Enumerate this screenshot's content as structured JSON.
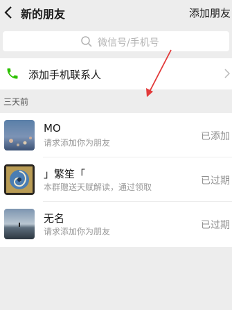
{
  "nav": {
    "title": "新的朋友",
    "action": "添加朋友"
  },
  "search": {
    "placeholder": "微信号/手机号"
  },
  "phone_contacts": {
    "label": "添加手机联系人"
  },
  "section": {
    "label": "三天前"
  },
  "requests": [
    {
      "name": "MO",
      "message": "请求添加你为朋友",
      "status": "已添加"
    },
    {
      "name": "」繁笙「",
      "message": "本群赠送天赋解读，通过领取",
      "status": "已过期"
    },
    {
      "name": "无名",
      "message": "请求添加你为朋友",
      "status": "已过期"
    }
  ],
  "colors": {
    "accent_green": "#2dc100",
    "annotation_red": "#e23a3a",
    "background": "#ededed"
  },
  "icons": [
    "back-arrow-icon",
    "search-icon",
    "phone-icon",
    "chevron-right-icon"
  ]
}
